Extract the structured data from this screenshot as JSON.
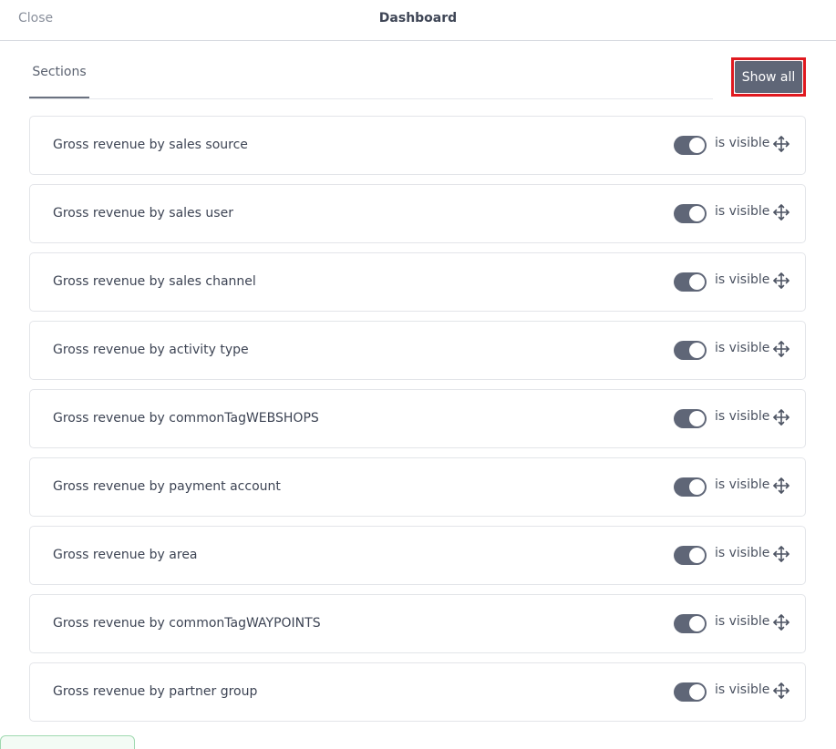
{
  "header": {
    "close_label": "Close",
    "title": "Dashboard"
  },
  "tabs": [
    {
      "label": "Sections",
      "active": true
    }
  ],
  "actions": {
    "show_all_label": "Show all"
  },
  "sections": [
    {
      "title": "Gross revenue by sales source",
      "visible": true,
      "visibility_label": "is visible"
    },
    {
      "title": "Gross revenue by sales user",
      "visible": true,
      "visibility_label": "is visible"
    },
    {
      "title": "Gross revenue by sales channel",
      "visible": true,
      "visibility_label": "is visible"
    },
    {
      "title": "Gross revenue by activity type",
      "visible": true,
      "visibility_label": "is visible"
    },
    {
      "title": "Gross revenue by commonTagWEBSHOPS",
      "visible": true,
      "visibility_label": "is visible"
    },
    {
      "title": "Gross revenue by payment account",
      "visible": true,
      "visibility_label": "is visible"
    },
    {
      "title": "Gross revenue by area",
      "visible": true,
      "visibility_label": "is visible"
    },
    {
      "title": "Gross revenue by commonTagWAYPOINTS",
      "visible": true,
      "visibility_label": "is visible"
    },
    {
      "title": "Gross revenue by partner group",
      "visible": true,
      "visibility_label": "is visible"
    }
  ],
  "icons": {
    "move_handle": "move-icon"
  },
  "colors": {
    "toggle_on": "#5f6677",
    "button_bg": "#5f6677",
    "highlight": "#e0191f",
    "text": "#3d4454"
  }
}
